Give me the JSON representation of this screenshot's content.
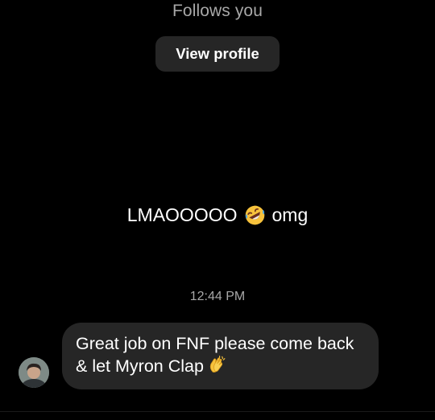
{
  "profile_header": {
    "follows_text": "Follows you",
    "view_profile_label": "View profile"
  },
  "messages": [
    {
      "id": "center-message",
      "text_before": "LMAOOOOO",
      "emoji": "rolling-on-floor-laughing-icon",
      "text_after": "omg"
    },
    {
      "id": "incoming-message",
      "line1": "Great job on FNF please come back",
      "line2": "& let Myron Clap",
      "emoji": "clapping-hands-icon"
    }
  ],
  "timestamp": "12:44 PM",
  "colors": {
    "background": "#000000",
    "bubble": "#262626",
    "secondary_text": "#a8a8a8",
    "button_bg": "#262626"
  }
}
